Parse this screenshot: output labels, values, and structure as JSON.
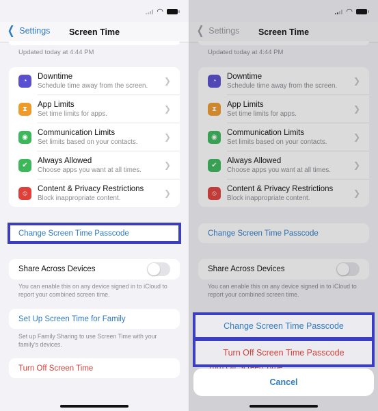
{
  "nav": {
    "back_label": "Settings",
    "title": "Screen Time"
  },
  "updated_text": "Updated today at 4:44 PM",
  "menu_items": [
    {
      "title": "Downtime",
      "subtitle": "Schedule time away from the screen.",
      "icon": "downtime-icon",
      "color": "#5b4fd1"
    },
    {
      "title": "App Limits",
      "subtitle": "Set time limits for apps.",
      "icon": "hourglass-icon",
      "color": "#f09a2a"
    },
    {
      "title": "Communication Limits",
      "subtitle": "Set limits based on your contacts.",
      "icon": "person-circle-icon",
      "color": "#3cb85a"
    },
    {
      "title": "Always Allowed",
      "subtitle": "Choose apps you want at all times.",
      "icon": "checkmark-badge-icon",
      "color": "#3cb85a"
    },
    {
      "title": "Content & Privacy Restrictions",
      "subtitle": "Block inappropriate content.",
      "icon": "restricted-icon",
      "color": "#e0403a"
    }
  ],
  "change_passcode_label": "Change Screen Time Passcode",
  "share": {
    "label": "Share Across Devices",
    "enabled": false,
    "footnote": "You can enable this on any device signed in to iCloud to report your combined screen time."
  },
  "family": {
    "label": "Set Up Screen Time for Family",
    "footnote": "Set up Family Sharing to use Screen Time with your family's devices."
  },
  "turn_off_label": "Turn Off Screen Time",
  "action_sheet": {
    "change_passcode": "Change Screen Time Passcode",
    "turn_off_passcode": "Turn Off Screen Time Passcode",
    "cancel": "Cancel"
  },
  "colors": {
    "link_blue": "#2f7bc4",
    "destructive_red": "#d1403a",
    "highlight_box": "#3b3fbf"
  }
}
